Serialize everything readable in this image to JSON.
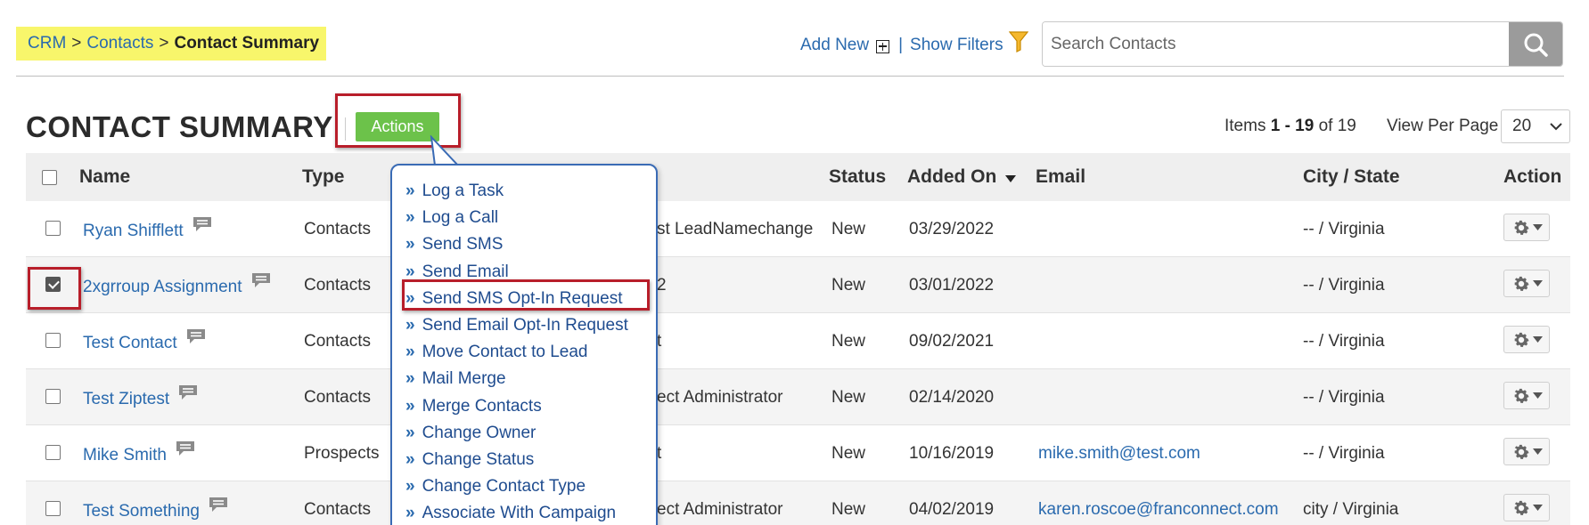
{
  "breadcrumb": {
    "crm": "CRM",
    "sep1": ">",
    "contacts": "Contacts",
    "sep2": ">",
    "current": "Contact Summary"
  },
  "toplinks": {
    "add_new": "Add New",
    "pipe": "|",
    "show_filters": "Show Filters"
  },
  "search": {
    "placeholder": "Search Contacts"
  },
  "header": {
    "title": "CONTACT SUMMARY",
    "actions_label": "Actions"
  },
  "pagination": {
    "items_prefix": "Items",
    "range": "1 - 19",
    "of_total": "of 19",
    "view_per_page_label": "View Per Page",
    "view_per_page_value": "20"
  },
  "table": {
    "columns": {
      "name": "Name",
      "type": "Type",
      "status": "Status",
      "added_on": "Added On",
      "email": "Email",
      "city_state": "City / State",
      "action": "Action"
    },
    "rows": [
      {
        "name": "Ryan Shifflett",
        "type": "Contacts",
        "hidden_col": "st LeadNamechange",
        "status": "New",
        "added_on": "03/29/2022",
        "email": "",
        "city_state": "-- / Virginia",
        "checked": false
      },
      {
        "name": "2xgrroup Assignment",
        "type": "Contacts",
        "hidden_col": "2",
        "status": "New",
        "added_on": "03/01/2022",
        "email": "",
        "city_state": "-- / Virginia",
        "checked": true
      },
      {
        "name": "Test Contact",
        "type": "Contacts",
        "hidden_col": "t",
        "status": "New",
        "added_on": "09/02/2021",
        "email": "",
        "city_state": "-- / Virginia",
        "checked": false
      },
      {
        "name": "Test Ziptest",
        "type": "Contacts",
        "hidden_col": "ect Administrator",
        "status": "New",
        "added_on": "02/14/2020",
        "email": "",
        "city_state": "-- / Virginia",
        "checked": false
      },
      {
        "name": "Mike Smith",
        "type": "Prospects",
        "hidden_col": "t",
        "status": "New",
        "added_on": "10/16/2019",
        "email": "mike.smith@test.com",
        "city_state": "-- / Virginia",
        "checked": false
      },
      {
        "name": "Test Something",
        "type": "Contacts",
        "hidden_col": "ect Administrator",
        "status": "New",
        "added_on": "04/02/2019",
        "email": "karen.roscoe@franconnect.com",
        "city_state": "city / Virginia",
        "checked": false
      }
    ]
  },
  "actions_menu": {
    "arrow_glyph": "»",
    "items": [
      "Log a Task",
      "Log a Call",
      "Send SMS",
      "Send Email",
      "Send SMS Opt-In Request",
      "Send Email Opt-In Request",
      "Move Contact to Lead",
      "Mail Merge",
      "Merge Contacts",
      "Change Owner",
      "Change Status",
      "Change Contact Type",
      "Associate With Campaign"
    ]
  },
  "colors": {
    "link": "#2a6aae",
    "actions_green": "#6cc24a",
    "highlight": "#f8f66b",
    "annotation_red": "#b81e2a",
    "menu_border": "#3a6bb5"
  },
  "icons": {
    "add": "plus-box-icon",
    "filter": "funnel-icon",
    "search": "magnifier-icon",
    "comment": "speech-bubble-icon",
    "row_action": "gear-icon",
    "sort": "caret-down-icon"
  }
}
